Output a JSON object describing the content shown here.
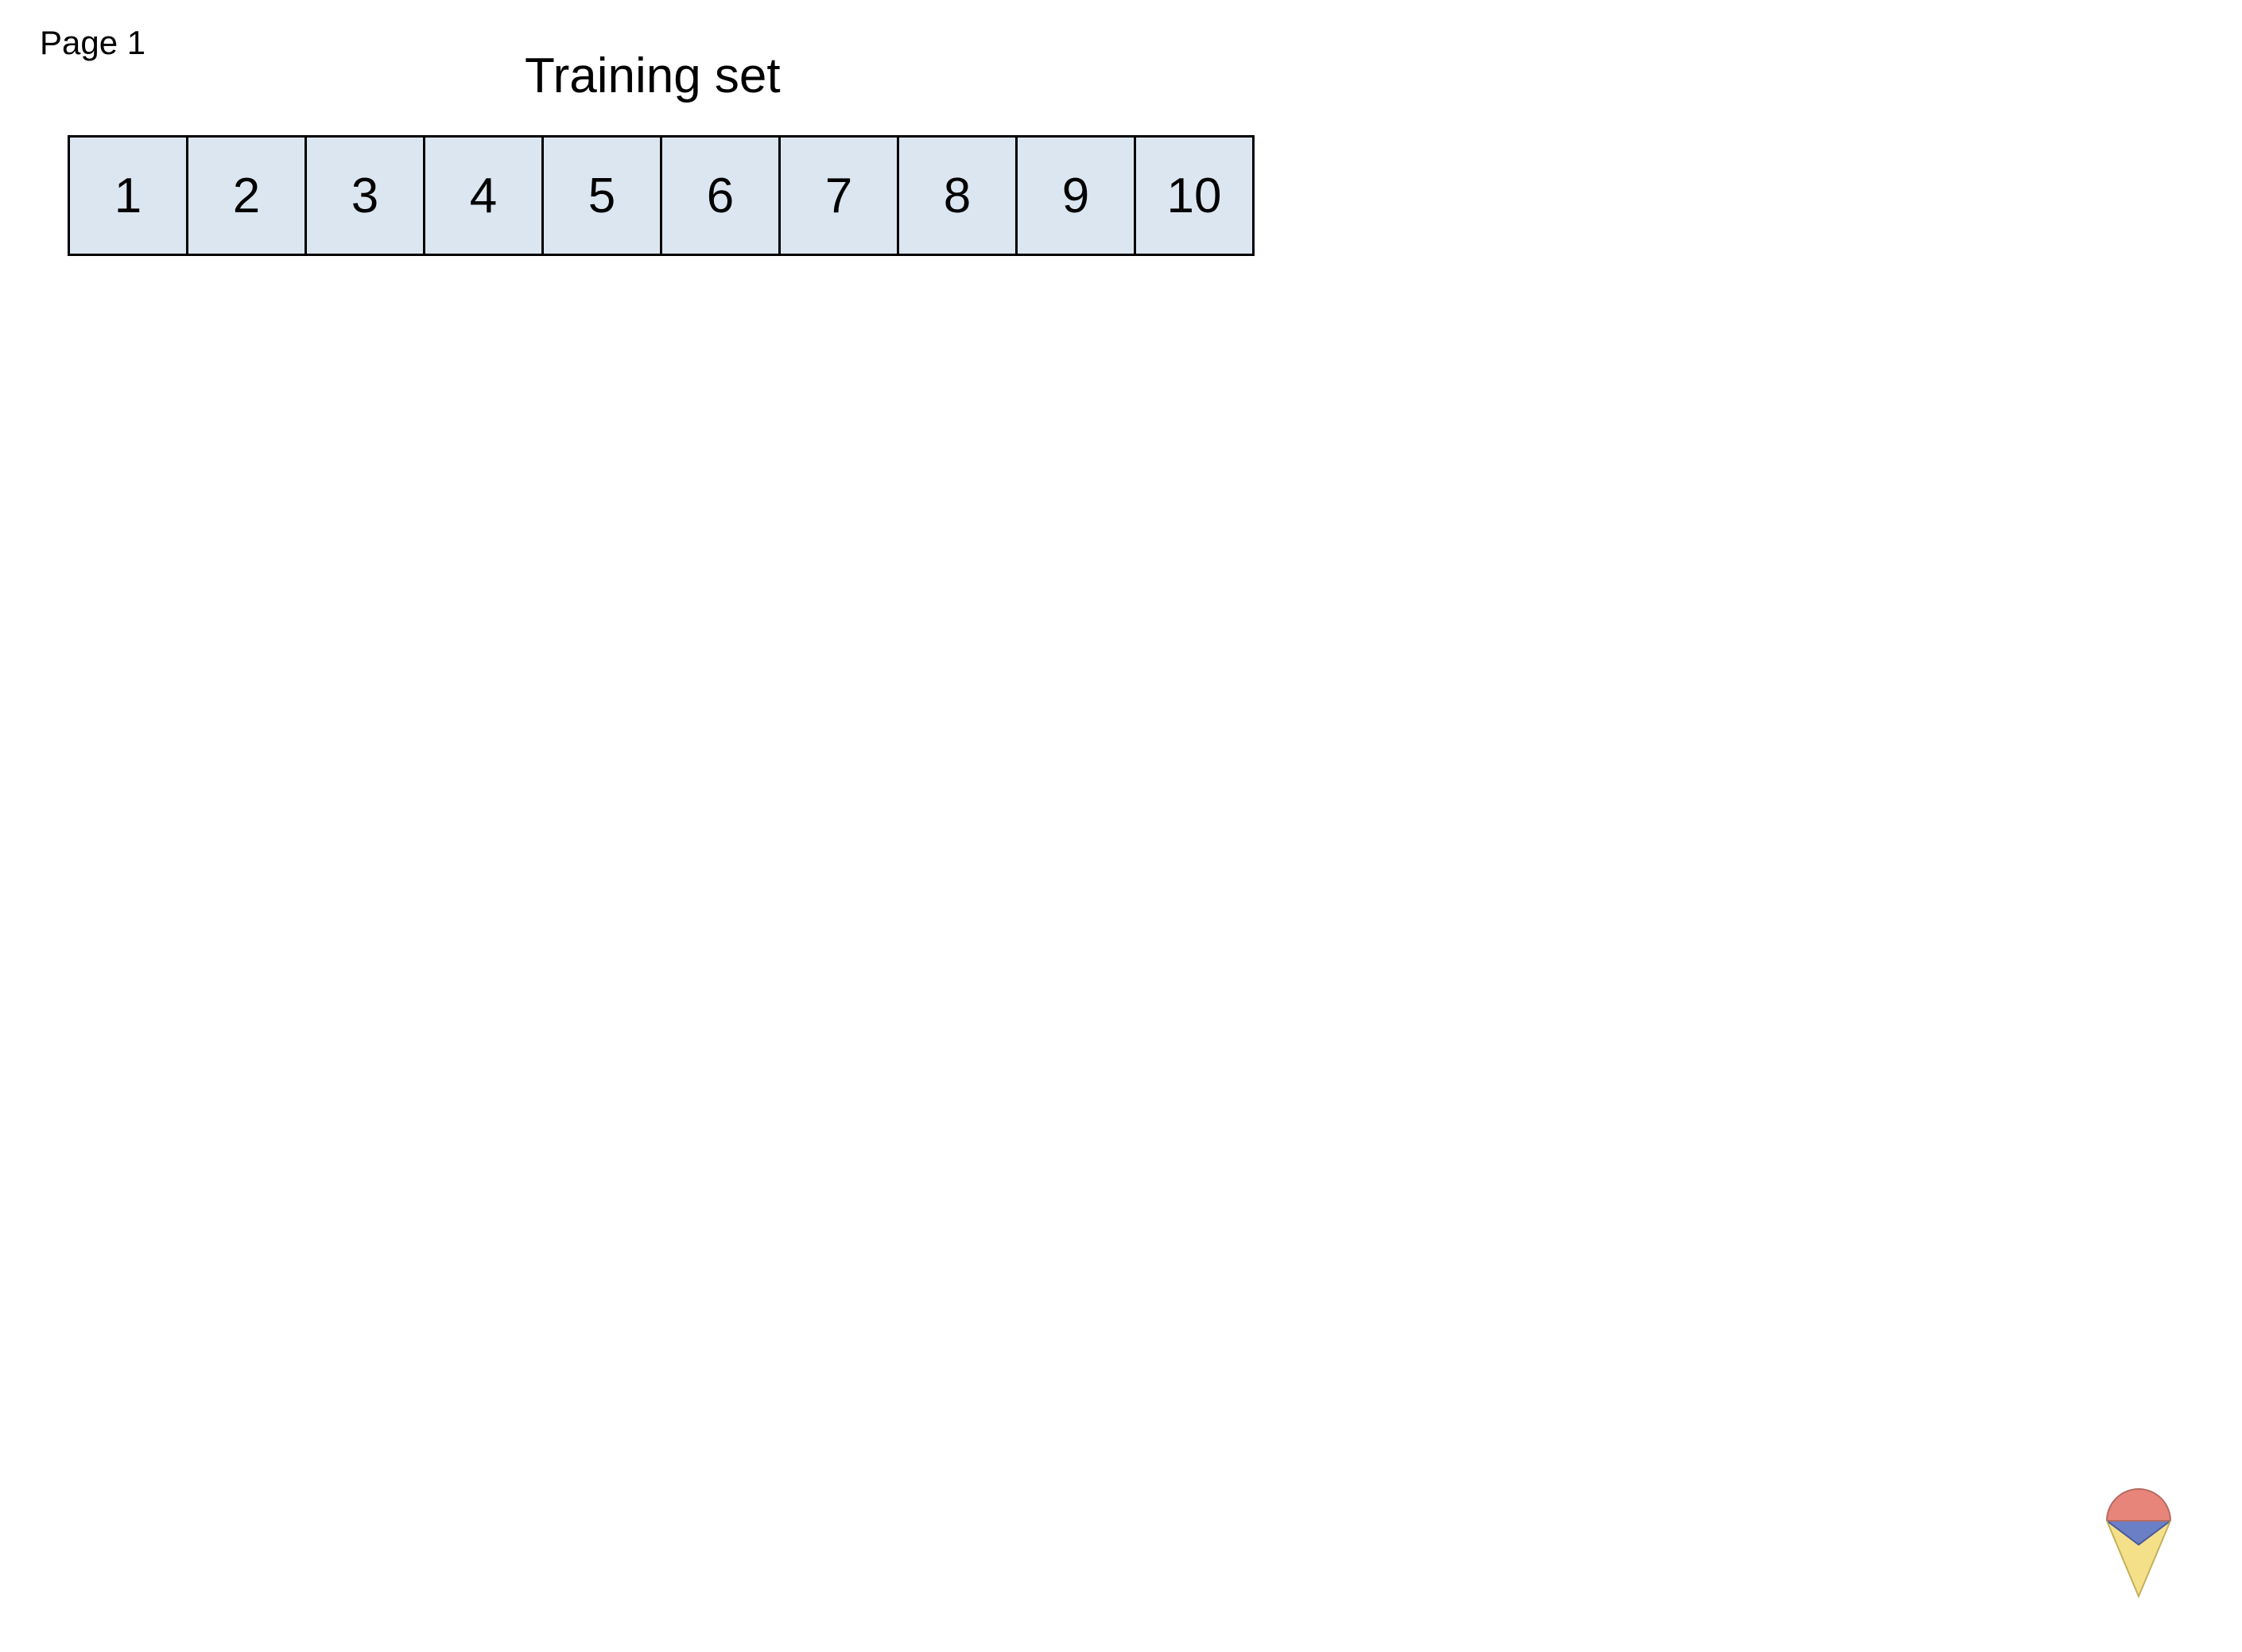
{
  "page_label": "Page 1",
  "title": "Training set",
  "cells": [
    "1",
    "2",
    "3",
    "4",
    "5",
    "6",
    "7",
    "8",
    "9",
    "10"
  ],
  "colors": {
    "cell_bg": "#dce6f1",
    "cell_border": "#000000"
  }
}
